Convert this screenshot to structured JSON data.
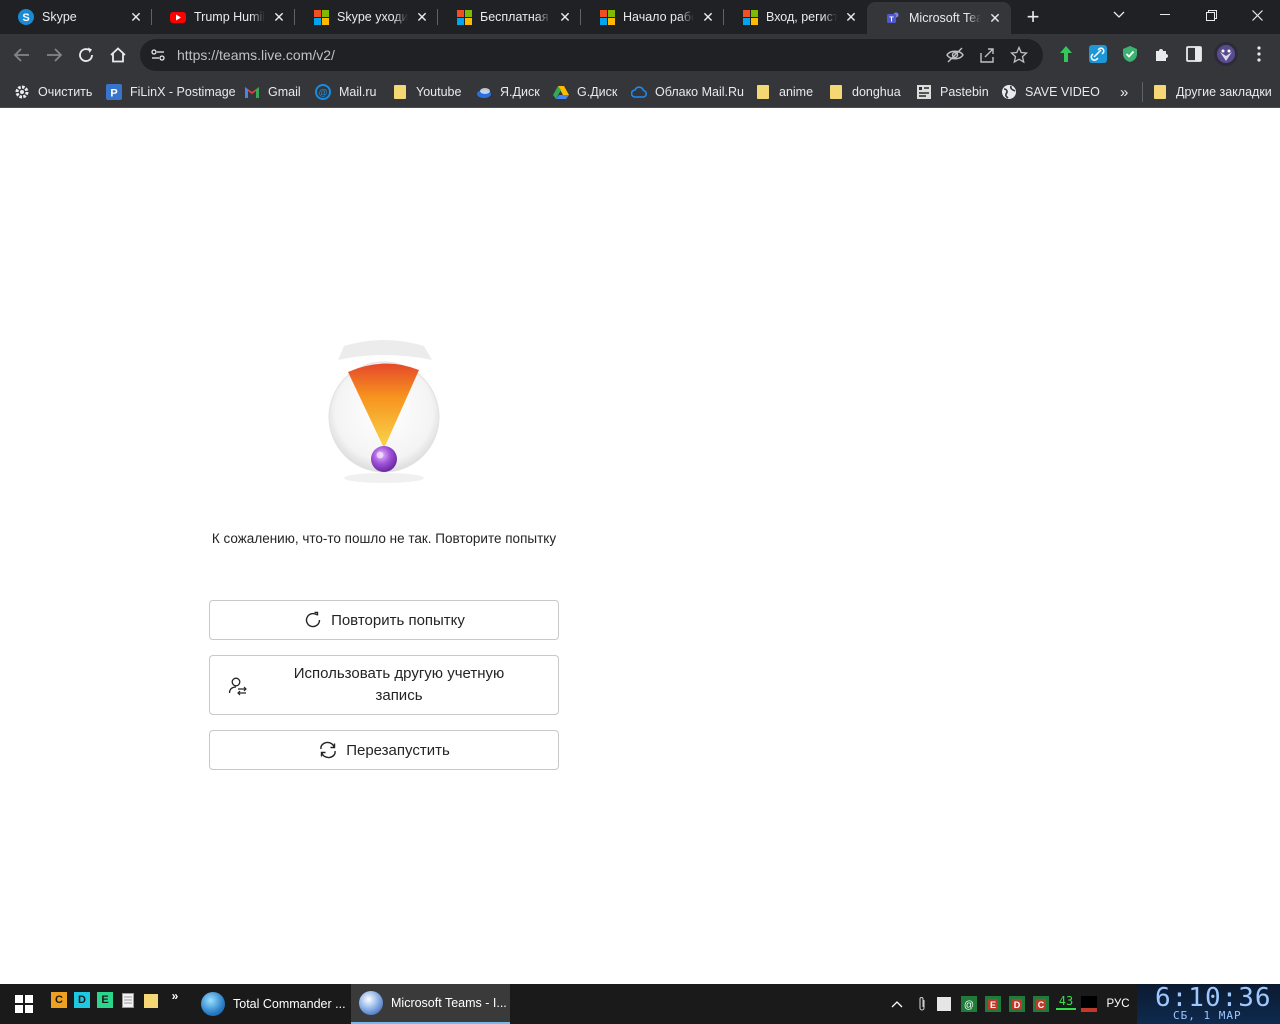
{
  "browser": {
    "tabs": [
      {
        "title": "Skype",
        "icon": "skype-icon"
      },
      {
        "title": "Trump Humiliates",
        "icon": "youtube-icon"
      },
      {
        "title": "Skype уходит",
        "icon": "microsoft-icon"
      },
      {
        "title": "Бесплатная ве",
        "icon": "microsoft-icon"
      },
      {
        "title": "Начало работ",
        "icon": "microsoft-icon"
      },
      {
        "title": "Вход, регистр",
        "icon": "microsoft-icon"
      },
      {
        "title": "Microsoft Teams",
        "icon": "teams-icon"
      }
    ],
    "url": "https://teams.live.com/v2/",
    "bookmarks": [
      {
        "label": "Очистить",
        "icon": "gear-icon"
      },
      {
        "label": "FiLinX - Postimage",
        "icon": "postimage-icon"
      },
      {
        "label": "Gmail",
        "icon": "gmail-icon"
      },
      {
        "label": "Mail.ru",
        "icon": "mailru-icon"
      },
      {
        "label": "Youtube",
        "icon": "folder-icon"
      },
      {
        "label": "Я.Диск",
        "icon": "yandex-disk-icon"
      },
      {
        "label": "G.Диск",
        "icon": "google-drive-icon"
      },
      {
        "label": "Облако Mail.Ru",
        "icon": "cloud-icon"
      },
      {
        "label": "anime",
        "icon": "folder-icon"
      },
      {
        "label": "donghua",
        "icon": "folder-icon"
      },
      {
        "label": "Pastebin",
        "icon": "pastebin-icon"
      },
      {
        "label": "SAVE VIDEO",
        "icon": "globe-icon"
      }
    ],
    "bookmarks_overflow": "»",
    "other_bookmarks": "Другие закладки"
  },
  "page": {
    "error_message": "К сожалению, что-то пошло не так. Повторите попытку",
    "buttons": {
      "retry": "Повторить попытку",
      "other_account": "Использовать другую учетную запись",
      "restart": "Перезапустить"
    }
  },
  "taskbar": {
    "quicklaunch": [
      "C",
      "D",
      "E"
    ],
    "overflow": "»",
    "apps": [
      {
        "label": "Total Commander ...",
        "active": false
      },
      {
        "label": "Microsoft Teams - I...",
        "active": true
      }
    ],
    "tray_counter": "43",
    "language": "РУС",
    "clock_time": "6:10:36",
    "clock_date": "СБ, 1  МАР"
  },
  "colors": {
    "tab_bg": "#202124",
    "toolbar_bg": "#35363a",
    "taskbar_bg": "#1a1a1a",
    "accent": "#76b9ed"
  }
}
